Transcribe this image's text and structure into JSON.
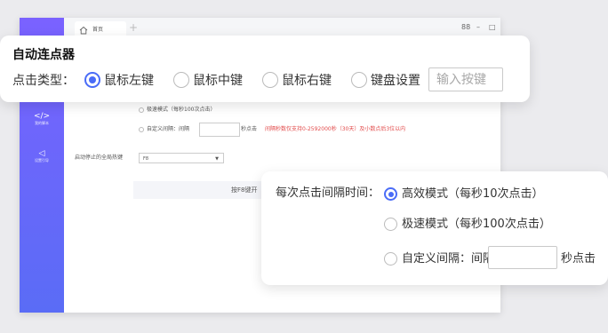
{
  "window": {
    "tab_label": "首页",
    "tab_add": "+",
    "controls": {
      "grid": "88",
      "minimize": "–",
      "maximize": "□",
      "close": "×"
    },
    "sidebar": [
      {
        "icon": "</>",
        "label": "我的脚本"
      },
      {
        "icon": "◁",
        "label": "设置引导"
      }
    ],
    "mini_options": {
      "fast_mode": "极速模式（每秒100次点击）",
      "custom_prefix": "自定义间隔：间隔",
      "custom_suffix": "秒点击",
      "custom_note": "间隔秒数仅支持0-2592000秒（30天）及小数点后3位以内"
    },
    "hotkey_label": "启动停止的全局热键",
    "hotkey_value": "F8",
    "hotkey_caret": "▼",
    "start_text": "按F8键开"
  },
  "top_card": {
    "title": "自动连点器",
    "click_type_label": "点击类型：",
    "options": [
      {
        "label": "鼠标左键",
        "checked": true
      },
      {
        "label": "鼠标中键",
        "checked": false
      },
      {
        "label": "鼠标右键",
        "checked": false
      },
      {
        "label": "键盘设置",
        "checked": false
      }
    ],
    "key_placeholder": "输入按键"
  },
  "right_card": {
    "interval_label": "每次点击间隔时间：",
    "options": [
      {
        "label": "高效模式（每秒10次点击）",
        "checked": true
      },
      {
        "label": "极速模式（每秒100次点击）",
        "checked": false
      },
      {
        "label": "自定义间隔：间隔",
        "checked": false
      }
    ],
    "seconds_label": "秒点击"
  },
  "colors": {
    "accent": "#4a6cf7",
    "sidebar_top": "#7a62ff",
    "sidebar_bottom": "#5a6cf6",
    "warning": "#e24b4b"
  }
}
